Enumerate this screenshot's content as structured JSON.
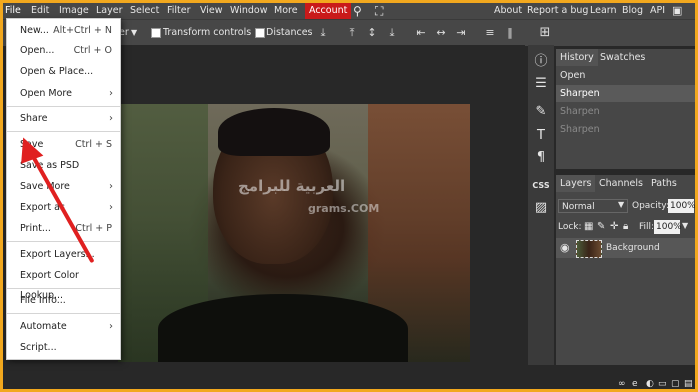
{
  "menubar": {
    "items": [
      "File",
      "Edit",
      "Image",
      "Layer",
      "Select",
      "Filter",
      "View",
      "Window",
      "More"
    ],
    "account": "Account",
    "right_items": [
      "About",
      "Report a bug",
      "Learn",
      "Blog",
      "API"
    ]
  },
  "options": {
    "dropdown_value": "er",
    "transform_controls": "Transform controls",
    "distances": "Distances"
  },
  "file_menu": {
    "items": [
      {
        "label": "New...",
        "shortcut": "Alt+Ctrl + N"
      },
      {
        "label": "Open...",
        "shortcut": "Ctrl + O"
      },
      {
        "label": "Open & Place...",
        "shortcut": ""
      },
      {
        "label": "Open More",
        "shortcut": "›"
      },
      {
        "label": "Share",
        "shortcut": "›"
      },
      {
        "label": "Save",
        "shortcut": "Ctrl + S"
      },
      {
        "label": "Save as PSD",
        "shortcut": ""
      },
      {
        "label": "Save More",
        "shortcut": "›"
      },
      {
        "label": "Export as",
        "shortcut": "›"
      },
      {
        "label": "Print...",
        "shortcut": "Ctrl + P"
      },
      {
        "label": "Export Layers...",
        "shortcut": ""
      },
      {
        "label": "Export Color Lookup...",
        "shortcut": ""
      },
      {
        "label": "File Info...",
        "shortcut": ""
      },
      {
        "label": "Automate",
        "shortcut": "›"
      },
      {
        "label": "Script...",
        "shortcut": ""
      }
    ]
  },
  "watermark": {
    "arabic": "العربية للبرامج",
    "latin": "grams.COM"
  },
  "history": {
    "tabs": [
      "History",
      "Swatches"
    ],
    "rows": [
      "Open",
      "Sharpen",
      "Sharpen",
      "Sharpen"
    ]
  },
  "layers": {
    "tabs": [
      "Layers",
      "Channels",
      "Paths"
    ],
    "blend_mode": "Normal",
    "opacity_label": "Opacity:",
    "opacity_value": "100%",
    "lock_label": "Lock:",
    "fill_label": "Fill:",
    "fill_value": "100%",
    "layer_name": "Background"
  },
  "right_tools": {
    "css_label": "CSS"
  },
  "colors": {
    "frame": "#f2a81e",
    "account_bg": "#c91a1a",
    "arrow": "#e02020"
  }
}
